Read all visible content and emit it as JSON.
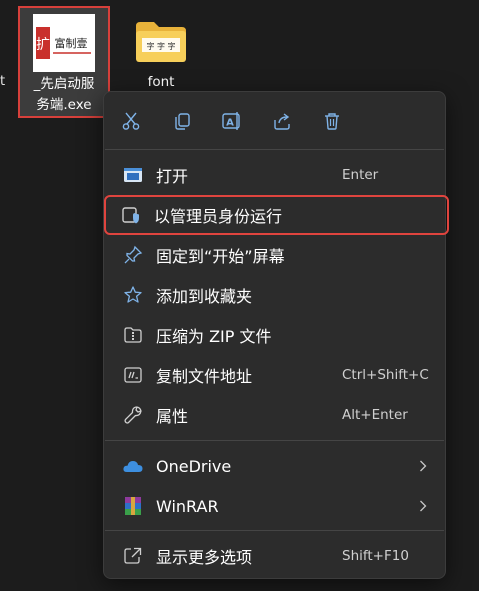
{
  "desktop": {
    "edge_label": "t",
    "exe": {
      "label_line1": "_先启动服",
      "label_line2": "务端.exe"
    },
    "folder": {
      "label": "font"
    }
  },
  "context_menu": {
    "toolbar": [
      {
        "name": "cut-icon"
      },
      {
        "name": "copy-icon"
      },
      {
        "name": "rename-icon"
      },
      {
        "name": "share-icon"
      },
      {
        "name": "delete-icon"
      }
    ],
    "items": [
      {
        "label": "打开",
        "shortcut": "Enter",
        "icon": "open-window-icon"
      },
      {
        "label": "以管理员身份运行",
        "shortcut": "",
        "icon": "shield-run-as-admin-icon",
        "highlighted": true
      },
      {
        "label": "固定到“开始”屏幕",
        "shortcut": "",
        "icon": "pin-icon"
      },
      {
        "label": "添加到收藏夹",
        "shortcut": "",
        "icon": "star-icon"
      },
      {
        "label": "压缩为 ZIP 文件",
        "shortcut": "",
        "icon": "zip-folder-icon"
      },
      {
        "label": "复制文件地址",
        "shortcut": "Ctrl+Shift+C",
        "icon": "copy-path-icon"
      },
      {
        "label": "属性",
        "shortcut": "Alt+Enter",
        "icon": "wrench-icon"
      },
      {
        "label": "OneDrive",
        "shortcut": "",
        "icon": "onedrive-cloud-icon",
        "submenu": true
      },
      {
        "label": "WinRAR",
        "shortcut": "",
        "icon": "winrar-icon",
        "submenu": true
      },
      {
        "label": "显示更多选项",
        "shortcut": "Shift+F10",
        "icon": "more-options-icon"
      }
    ]
  },
  "colors": {
    "background": "#1c1c1c",
    "menu_bg": "#2c2c2c",
    "highlight_border": "#e0443e",
    "icon_blue": "#7fb3e8",
    "onedrive_blue": "#3d8fe0"
  }
}
